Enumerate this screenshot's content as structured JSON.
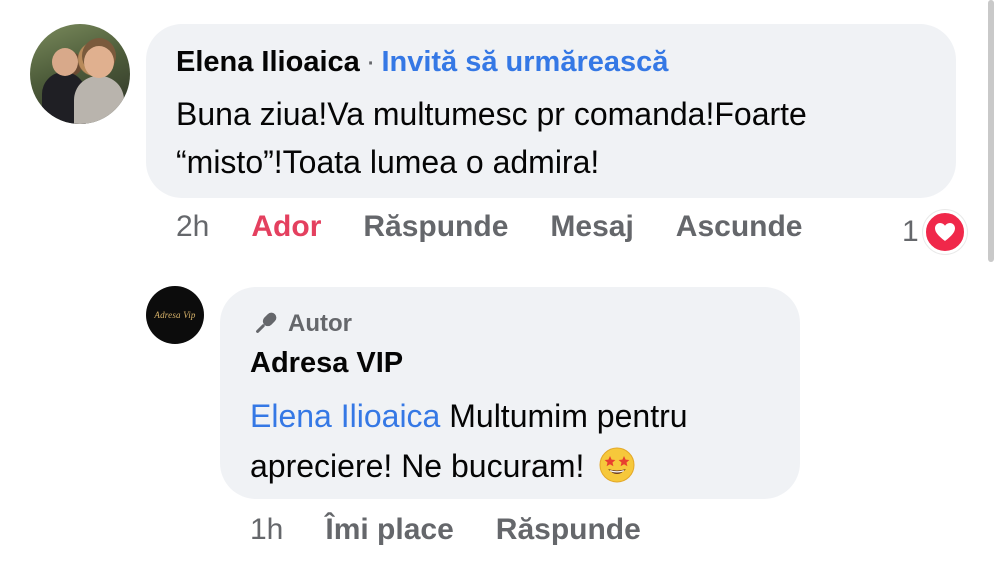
{
  "comment": {
    "author": "Elena Ilioaica",
    "separator": "·",
    "invite_label": "Invită să urmărească",
    "text": "Buna ziua!Va multumesc pr comanda!Foarte “misto”!Toata lumea o admira!",
    "time": "2h",
    "actions": {
      "react": "Ador",
      "reply": "Răspunde",
      "message": "Mesaj",
      "hide": "Ascunde"
    },
    "reaction_count": "1",
    "reaction_icon": "heart-icon",
    "reaction_color": "#f0284a"
  },
  "reply": {
    "avatar_text": "Adresa Vip",
    "badge": "Autor",
    "badge_icon": "microphone-icon",
    "author": "Adresa VIP",
    "mention": "Elena Ilioaica",
    "text": " Multumim pentru apreciere! Ne bucuram! ",
    "emoji": "star-struck-emoji",
    "time": "1h",
    "actions": {
      "like": "Îmi place",
      "reply": "Răspunde"
    }
  },
  "colors": {
    "link": "#3578e5",
    "loved": "#e4405f",
    "muted": "#65676b",
    "bubble": "#f0f2f5"
  }
}
